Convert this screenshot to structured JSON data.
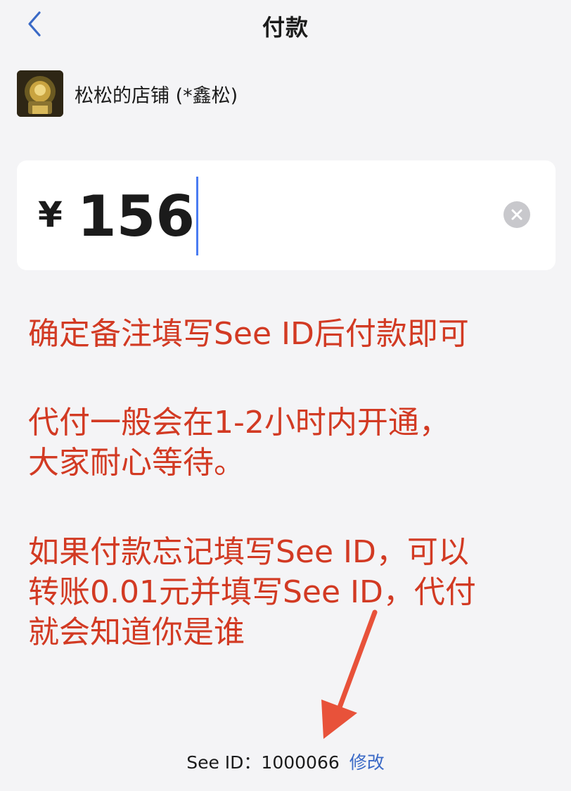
{
  "header": {
    "title": "付款",
    "back_icon": "chevron-left-icon"
  },
  "merchant": {
    "name": "松松的店铺 (*鑫松)"
  },
  "amount": {
    "currency_symbol": "¥",
    "value": "156",
    "clear_icon": "clear-circle-icon"
  },
  "notices": [
    {
      "lines": [
        "确定备注填写See ID后付款即可"
      ]
    },
    {
      "lines": [
        "代付一般会在1-2小时内开通，",
        "大家耐心等待。"
      ]
    },
    {
      "lines": [
        "如果付款忘记填写See ID，可以",
        "转账0.01元并填写See ID，代付",
        "就会知道你是谁"
      ]
    }
  ],
  "footer": {
    "label": "See ID：",
    "value": "1000066",
    "modify_label": "修改"
  },
  "colors": {
    "accent_blue": "#3a69c6",
    "caret_blue": "#4a7cf2",
    "notice_red": "#d23a23",
    "background": "#f4f4f6"
  }
}
